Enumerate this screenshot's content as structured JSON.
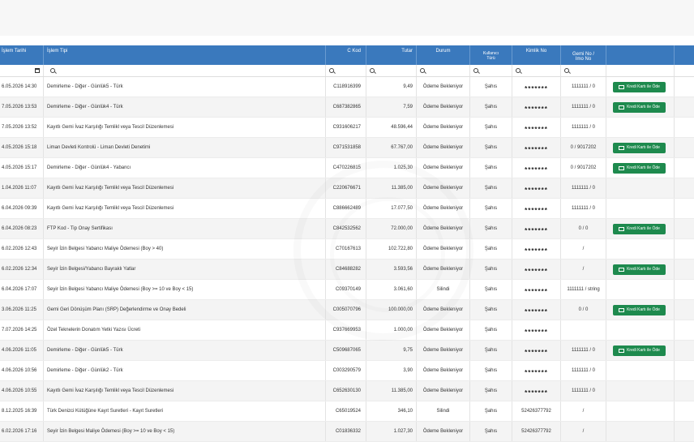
{
  "table": {
    "headers": {
      "islem_tarihi": "İşlem Tarihi",
      "islem_tipi": "İşlem Tipi",
      "c_kod": "C Kod",
      "tutar": "Tutar",
      "durum": "Durum",
      "kullanici_turu_1": "Kullanıcı",
      "kullanici_turu_2": "Türü",
      "kimlik_no": "Kimlik No",
      "gemi_no_1": "Gemi No /",
      "gemi_no_2": "Imo No"
    },
    "pay_button_label": "Kredi Kartı ile Öde",
    "rows": [
      {
        "date": "6.05.2026 14:30",
        "type": "Demirleme - Diğer - Günlük5 - Türk",
        "code": "C118916399",
        "amount": "9,49",
        "status": "Ödeme Bekleniyor",
        "user_type": "Şahıs",
        "id": "*******",
        "ship": "1111111 / 0",
        "pay": true
      },
      {
        "date": "7.05.2026 13:53",
        "type": "Demirleme - Diğer - Günlük4 - Türk",
        "code": "C687382865",
        "amount": "7,59",
        "status": "Ödeme Bekleniyor",
        "user_type": "Şahıs",
        "id": "*******",
        "ship": "1111111 / 0",
        "pay": true
      },
      {
        "date": "7.05.2026 13:52",
        "type": "Kayıtlı Gemi İvaz Karşılığı Temlikl veya Tescil Düzenlemesi",
        "code": "C931606217",
        "amount": "48.596,44",
        "status": "Ödeme Bekleniyor",
        "user_type": "Şahıs",
        "id": "*******",
        "ship": "1111111 / 0",
        "pay": false
      },
      {
        "date": "4.05.2026 15:18",
        "type": "Liman Devleti Kontrolü - Liman Devleti Denetimi",
        "code": "C971531858",
        "amount": "67.767,00",
        "status": "Ödeme Bekleniyor",
        "user_type": "Şahıs",
        "id": "*******",
        "ship": "0 / 9017202",
        "pay": true
      },
      {
        "date": "4.05.2026 15:17",
        "type": "Demirleme - Diğer - Günlük4 - Yabancı",
        "code": "C470226815",
        "amount": "1.025,30",
        "status": "Ödeme Bekleniyor",
        "user_type": "Şahıs",
        "id": "*******",
        "ship": "0 / 9017202",
        "pay": true
      },
      {
        "date": "1.04.2026 11:07",
        "type": "Kayıtlı Gemi İvaz Karşılığı Temlikl veya Tescil Düzenlemesi",
        "code": "C220676671",
        "amount": "11.385,00",
        "status": "Ödeme Bekleniyor",
        "user_type": "Şahıs",
        "id": "*******",
        "ship": "1111111 / 0",
        "pay": false
      },
      {
        "date": "6.04.2026 09:39",
        "type": "Kayıtlı Gemi İvaz Karşılığı Temlikl veya Tescil Düzenlemesi",
        "code": "C886662489",
        "amount": "17.077,50",
        "status": "Ödeme Bekleniyor",
        "user_type": "Şahıs",
        "id": "*******",
        "ship": "1111111 / 0",
        "pay": false
      },
      {
        "date": "6.04.2026 08:23",
        "type": "FTP Kod - Tip Onay Sertifikası",
        "code": "C842532562",
        "amount": "72.000,00",
        "status": "Ödeme Bekleniyor",
        "user_type": "Şahıs",
        "id": "*******",
        "ship": "0 / 0",
        "pay": true
      },
      {
        "date": "6.02.2026 12:43",
        "type": "Seyir İzin Belgesi Yabancı Maliye Ödemesi (Boy > 40)",
        "code": "C70167613",
        "amount": "102.722,80",
        "status": "Ödeme Bekleniyor",
        "user_type": "Şahıs",
        "id": "*******",
        "ship": "/",
        "pay": false
      },
      {
        "date": "6.02.2026 12:34",
        "type": "Seyir İzin Belgesi/Yabancı Bayraklı Yatlar",
        "code": "C84688282",
        "amount": "3.593,56",
        "status": "Ödeme Bekleniyor",
        "user_type": "Şahıs",
        "id": "*******",
        "ship": "/",
        "pay": true
      },
      {
        "date": "6.04.2026 17:07",
        "type": "Seyir İzin Belgesi Yabancı Maliye Ödemesi (Boy >= 10 ve Boy < 15)",
        "code": "C09370149",
        "amount": "3.061,60",
        "status": "Silindi",
        "user_type": "Şahıs",
        "id": "*******",
        "ship": "1111111 / string",
        "pay": false
      },
      {
        "date": "3.06.2026 11:25",
        "type": "Gemi Geri Dönüşüm Planı (SRP) Değerlendirme ve Onay Bedeli",
        "code": "C005070796",
        "amount": "100.000,00",
        "status": "Ödeme Bekleniyor",
        "user_type": "Şahıs",
        "id": "*******",
        "ship": "0 / 0",
        "pay": true
      },
      {
        "date": "7.07.2026 14:25",
        "type": "Özel Teknelerin Donatım Yetki Yazısı Ücreti",
        "code": "C937669953",
        "amount": "1.000,00",
        "status": "Ödeme Bekleniyor",
        "user_type": "Şahıs",
        "id": "*******",
        "ship": "",
        "pay": false
      },
      {
        "date": "4.06.2026 11:05",
        "type": "Demirleme - Diğer - Günlük5 - Türk",
        "code": "C509687065",
        "amount": "9,75",
        "status": "Ödeme Bekleniyor",
        "user_type": "Şahıs",
        "id": "*******",
        "ship": "1111111 / 0",
        "pay": true
      },
      {
        "date": "4.06.2026 10:56",
        "type": "Demirleme - Diğer - Günlük2 - Türk",
        "code": "C003290579",
        "amount": "3,90",
        "status": "Ödeme Bekleniyor",
        "user_type": "Şahıs",
        "id": "*******",
        "ship": "1111111 / 0",
        "pay": false
      },
      {
        "date": "4.06.2026 10:55",
        "type": "Kayıtlı Gemi İvaz Karşılığı Temlikl veya Tescil Düzenlemesi",
        "code": "C652630130",
        "amount": "11.385,00",
        "status": "Ödeme Bekleniyor",
        "user_type": "Şahıs",
        "id": "*******",
        "ship": "1111111 / 0",
        "pay": false
      },
      {
        "date": "8.12.2025 16:39",
        "type": "Türk Denizci Kütüğüne Kayıt Suretleri - Kayıt Suretleri",
        "code": "C65019524",
        "amount": "346,10",
        "status": "Silindi",
        "user_type": "Şahıs",
        "id": "52426377792",
        "ship": "/",
        "pay": false
      },
      {
        "date": "6.02.2026 17:16",
        "type": "Seyir İzin Belgesi Maliye Ödemesi (Boy >= 10 ve Boy < 15)",
        "code": "C01836332",
        "amount": "1.027,30",
        "status": "Ödeme Bekleniyor",
        "user_type": "Şahıs",
        "id": "52426377792",
        "ship": "/",
        "pay": false
      }
    ]
  }
}
